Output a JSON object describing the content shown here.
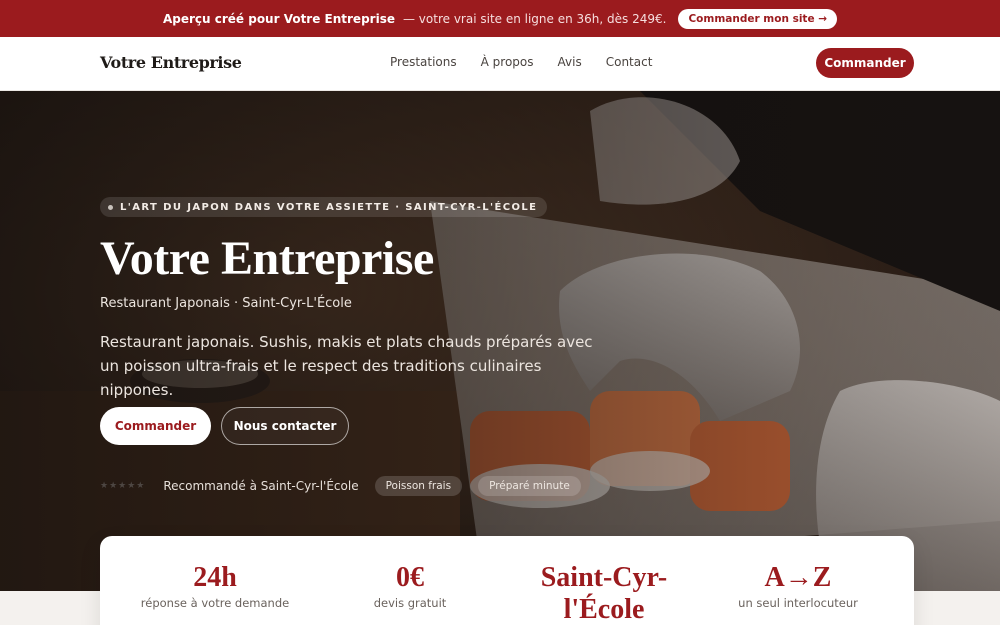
{
  "promo": {
    "lead": "Aperçu créé pour Votre Entreprise",
    "rest": "— votre vrai site en ligne en 36h, dès 249€.",
    "button": "Commander mon site →"
  },
  "nav": {
    "brand": "Votre Entreprise",
    "links": [
      "Prestations",
      "À propos",
      "Avis",
      "Contact"
    ],
    "cta": "Commander"
  },
  "hero": {
    "eyebrow": "L'ART DU JAPON DANS VOTRE ASSIETTE · SAINT-CYR-L'ÉCOLE",
    "title": "Votre Entreprise",
    "subtitle": "Restaurant Japonais · Saint-Cyr-L'École",
    "description": "Restaurant japonais. Sushis, makis et plats chauds préparés avec un poisson ultra-frais et le respect des traditions culinaires nippones.",
    "primary_button": "Commander",
    "secondary_button": "Nous contacter",
    "rating_stars": "★★★★★",
    "social_proof": "Recommandé à Saint-Cyr-l'École",
    "chips": [
      "Poisson frais",
      "Préparé minute"
    ]
  },
  "stats": [
    {
      "value": "24h",
      "label": "réponse à votre demande"
    },
    {
      "value": "0€",
      "label": "devis gratuit"
    },
    {
      "value": "Saint-Cyr-l'École",
      "label": ""
    },
    {
      "value": "A→Z",
      "label": "un seul interlocuteur"
    }
  ],
  "colors": {
    "accent": "#9b1b1e"
  }
}
